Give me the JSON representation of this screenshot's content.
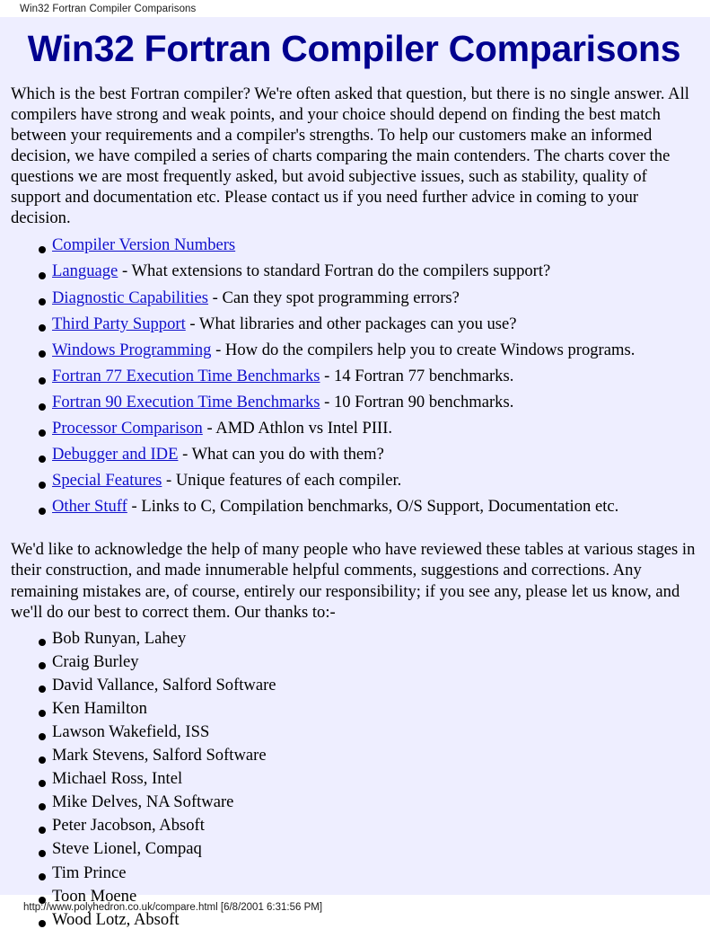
{
  "print_header": {
    "title": "Win32 Fortran Compiler Comparisons"
  },
  "page": {
    "heading": "Win32 Fortran Compiler Comparisons",
    "intro_paragraph": "Which is the best Fortran compiler? We're often asked that question, but there is no single answer. All compilers have strong and weak points, and your choice should depend on finding the best match between your requirements and a compiler's strengths. To help our customers make an informed decision, we have compiled a series of charts comparing the main contenders. The charts cover the questions we are most frequently asked, but avoid subjective issues, such as stability, quality of support and documentation etc. Please contact us if you need further advice in coming to your decision.",
    "acknowledgement_paragraph": "We'd like to acknowledge the help of many people who have reviewed these tables at various stages in their construction, and made innumerable helpful comments, suggestions and corrections. Any remaining mistakes are, of course, entirely our responsibility; if you see any, please let us know, and we'll do our best to correct them. Our thanks to:-"
  },
  "link_list": [
    {
      "link": "Compiler Version Numbers",
      "desc": ""
    },
    {
      "link": "Language",
      "desc": " - What extensions to standard Fortran do the compilers support?"
    },
    {
      "link": "Diagnostic Capabilities",
      "desc": " - Can they spot programming errors?"
    },
    {
      "link": "Third Party Support",
      "desc": " - What libraries and other packages can you use?"
    },
    {
      "link": "Windows Programming",
      "desc": " - How do the compilers help you to create Windows programs."
    },
    {
      "link": "Fortran 77 Execution Time Benchmarks",
      "desc": " - 14 Fortran 77 benchmarks."
    },
    {
      "link": "Fortran 90 Execution Time Benchmarks",
      "desc": "  - 10 Fortran 90 benchmarks."
    },
    {
      "link": "Processor Comparison",
      "desc": " - AMD Athlon vs Intel PIII."
    },
    {
      "link": "Debugger and IDE",
      "desc": " - What can you do with them?"
    },
    {
      "link": "Special Features",
      "desc": " - Unique features of each compiler."
    },
    {
      "link": "Other Stuff",
      "desc": " - Links to C, Compilation benchmarks, O/S Support, Documentation etc."
    }
  ],
  "thanks_list": [
    "Bob Runyan, Lahey",
    "Craig Burley",
    "David Vallance, Salford Software",
    "Ken Hamilton",
    "Lawson Wakefield, ISS",
    "Mark Stevens, Salford Software",
    "Michael Ross, Intel",
    "Mike Delves, NA Software",
    "Peter Jacobson, Absoft",
    "Steve Lionel, Compaq",
    "Tim Prince",
    "Toon Moene",
    "Wood Lotz, Absoft"
  ],
  "print_footer": {
    "url_and_timestamp": "http://www.polyhedron.co.uk/compare.html [6/8/2001 6:31:56 PM]"
  },
  "colors": {
    "page_background": "#eeeeff",
    "heading": "#00008f",
    "link": "#1111cc",
    "text": "#000000",
    "chrome_background": "#ffffff"
  }
}
